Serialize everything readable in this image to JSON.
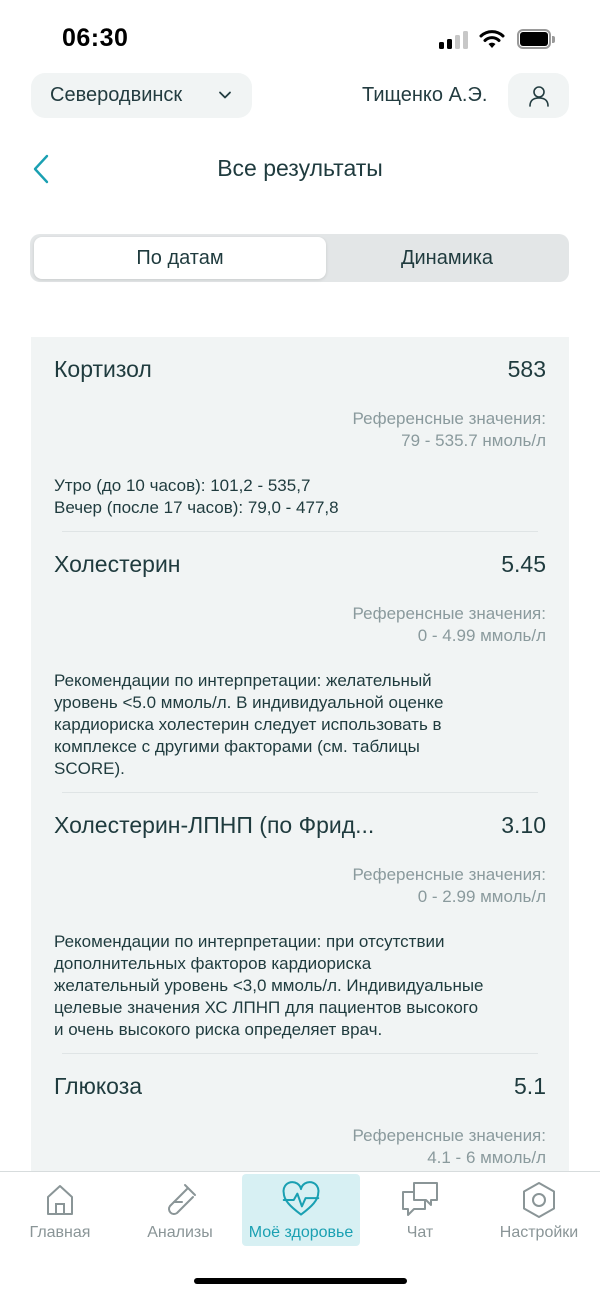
{
  "status": {
    "time": "06:30"
  },
  "header": {
    "city": "Северодвинск",
    "user_name": "Тищенко А.Э."
  },
  "page": {
    "title": "Все результаты"
  },
  "segments": {
    "by_date": "По датам",
    "dynamics": "Динамика"
  },
  "results": [
    {
      "name": "Кортизол",
      "value": "583",
      "ref_label": "Референсные значения:",
      "ref_value": "79 - 535.7 нмоль/л",
      "note": "Утро (до 10 часов): 101,2 - 535,7\nВечер (после 17 часов): 79,0 - 477,8"
    },
    {
      "name": "Холестерин",
      "value": "5.45",
      "ref_label": "Референсные значения:",
      "ref_value": "0 - 4.99 ммоль/л",
      "note": "Рекомендации по интерпретации: желательный\nуровень <5.0 ммоль/л. В индивидуальной оценке\nкардиориска холестерин следует использовать в\nкомплексе с другими факторами (см. таблицы\nSCORE)."
    },
    {
      "name": "Холестерин-ЛПНП (по Фрид...",
      "value": "3.10",
      "ref_label": "Референсные значения:",
      "ref_value": "0 - 2.99 ммоль/л",
      "note": "Рекомендации по интерпретации: при отсутствии\nдополнительных факторов кардиориска\nжелательный уровень <3,0 ммоль/л. Индивидуальные\nцелевые значения ХС ЛПНП для пациентов высокого\nи очень высокого риска определяет врач."
    },
    {
      "name": "Глюкоза",
      "value": "5.1",
      "ref_label": "Референсные значения:",
      "ref_value": "4.1 - 6 ммоль/л",
      "note": ""
    }
  ],
  "tabs": [
    {
      "label": "Главная",
      "icon": "home-icon"
    },
    {
      "label": "Анализы",
      "icon": "test-tube-icon"
    },
    {
      "label": "Моё здоровье",
      "icon": "heart-pulse-icon"
    },
    {
      "label": "Чат",
      "icon": "chat-icon"
    },
    {
      "label": "Настройки",
      "icon": "settings-icon"
    }
  ],
  "colors": {
    "accent": "#1aa0b2",
    "active_tab_bg": "#d7f0f3",
    "card_bg": "#f1f4f4"
  }
}
